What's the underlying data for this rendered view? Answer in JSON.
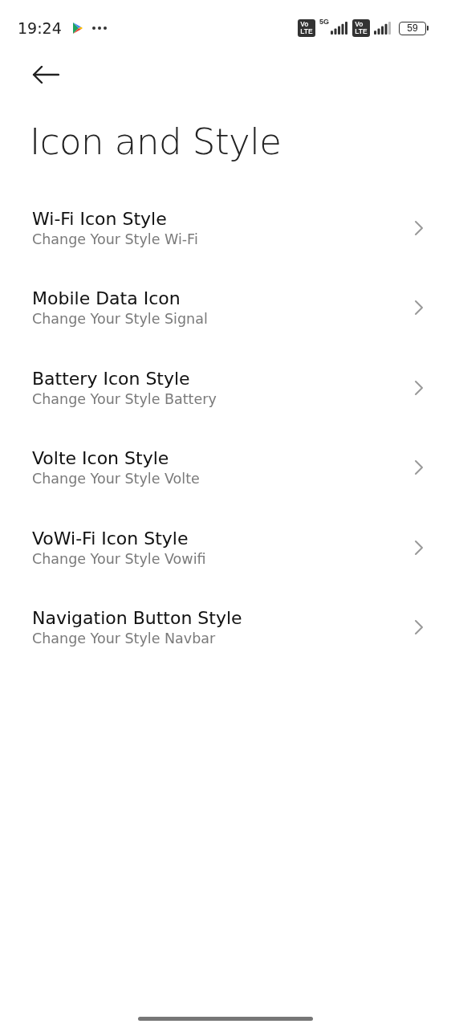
{
  "status_bar": {
    "time": "19:24",
    "network": "5G",
    "battery": "59",
    "volte_badges": [
      {
        "top": "Vo",
        "bottom": "LTE"
      },
      {
        "top": "Vo",
        "bottom": "LTE"
      }
    ]
  },
  "header": {
    "title": "Icon and Style"
  },
  "items": [
    {
      "title": "Wi-Fi Icon Style",
      "subtitle": "Change Your Style Wi-Fi"
    },
    {
      "title": "Mobile Data Icon",
      "subtitle": "Change Your Style Signal"
    },
    {
      "title": "Battery Icon Style",
      "subtitle": "Change Your Style Battery"
    },
    {
      "title": "Volte Icon Style",
      "subtitle": "Change Your Style Volte"
    },
    {
      "title": "VoWi-Fi Icon Style",
      "subtitle": "Change Your Style Vowifi"
    },
    {
      "title": "Navigation Button Style",
      "subtitle": "Change Your Style Navbar"
    }
  ]
}
